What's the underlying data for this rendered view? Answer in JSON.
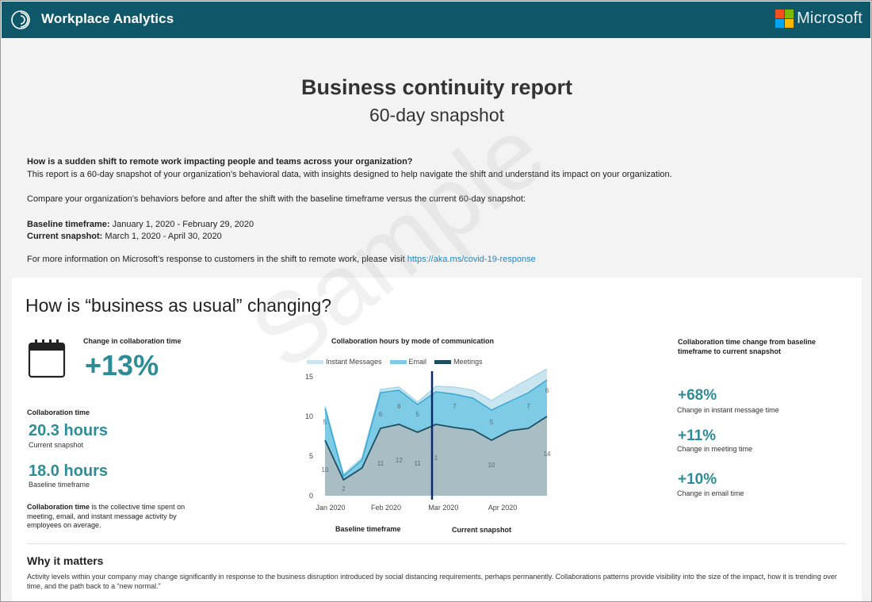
{
  "header": {
    "app_title": "Workplace Analytics",
    "brand": "Microsoft",
    "logo_icon": "workplace-analytics-logo"
  },
  "report": {
    "title": "Business continuity report",
    "subtitle": "60-day snapshot",
    "question": "How is a sudden shift to remote work impacting people and teams across your organization?",
    "intro": "This report is a 60-day snapshot of your organization’s behavioral data, with insights designed to help navigate the shift and understand its impact on your organization.",
    "compare": "Compare your organization’s behaviors before and after the shift with the baseline timeframe versus the current 60-day snapshot:",
    "baseline_label": "Baseline timeframe:",
    "baseline_value": " January 1, 2020 - February 29, 2020",
    "current_label": "Current snapshot:",
    "current_value": " March 1, 2020 - April 30, 2020",
    "more_info": "For more information on Microsoft’s response to customers in the shift to remote work, please visit ",
    "link": "https://aka.ms/covid-19-response"
  },
  "section": {
    "heading": "How is “business as usual” changing?",
    "change_label": "Change in collaboration time",
    "change_value": "+13%",
    "collab_label": "Collaboration time",
    "current_hours": "20.3 hours",
    "current_hours_label": "Current snapshot",
    "baseline_hours": "18.0 hours",
    "baseline_hours_label": "Baseline timeframe",
    "desc_bold": "Collaboration time",
    "desc_rest": " is the collective time spent on meeting, email, and instant message activity by employees on average.",
    "right_title": "Collaboration time change from baseline timeframe to current snapshot",
    "kpis": [
      {
        "value": "+68%",
        "label": "Change in instant message time"
      },
      {
        "value": "+11%",
        "label": "Change in meeting time"
      },
      {
        "value": "+10%",
        "label": "Change in email time"
      }
    ],
    "why_heading": "Why it matters",
    "why_text": "Activity levels within your company may change significantly in response to the business disruption introduced by social distancing requirements, perhaps permanently. Collaborations patterns provide visibility into the size of the impact, how it is trending over time, and the path back to a “new normal.”",
    "watermark": "Sample"
  },
  "colors": {
    "teal_header": "#0f5869",
    "accent": "#2e8c96",
    "im": "#c9e6f0",
    "email": "#7ecbe6",
    "meetings": "#1f4e61"
  },
  "chart_data": {
    "type": "area",
    "title": "Collaboration hours by mode of communication",
    "legend": [
      "Instant Messages",
      "Email",
      "Meetings"
    ],
    "legend_placement": "top",
    "stacked": true,
    "x_tick_labels": [
      "Jan 2020",
      "Feb 2020",
      "Mar 2020",
      "Apr 2020"
    ],
    "yticks": [
      "0",
      "5",
      "10",
      "15"
    ],
    "ylim": [
      0,
      15
    ],
    "divider_label_left": "Baseline timeframe",
    "divider_label_right": "Current snapshot",
    "series": [
      {
        "name": "Meetings",
        "values": [
          7.0,
          2.0,
          3.5,
          8.5,
          9.0,
          8.0,
          9.0,
          8.6,
          8.3,
          7.0,
          8.2,
          8.5,
          10.0
        ]
      },
      {
        "name": "Email",
        "values": [
          4.0,
          0.5,
          1.0,
          4.5,
          4.3,
          3.5,
          4.1,
          4.2,
          4.0,
          3.8,
          3.7,
          4.5,
          4.6
        ]
      },
      {
        "name": "Instant Messages",
        "values": [
          0.3,
          0.2,
          0.3,
          0.4,
          0.4,
          0.3,
          0.7,
          0.9,
          1.0,
          1.2,
          1.5,
          1.7,
          1.4
        ]
      }
    ],
    "data_labels": [
      {
        "text": "5",
        "index": 0,
        "level": 9
      },
      {
        "text": "10",
        "index": 0,
        "level": 3
      },
      {
        "text": "2",
        "index": 1,
        "level": 0.6
      },
      {
        "text": "6",
        "index": 3,
        "level": 10
      },
      {
        "text": "11",
        "index": 3,
        "level": 3.8
      },
      {
        "text": "6",
        "index": 4,
        "level": 11
      },
      {
        "text": "12",
        "index": 4,
        "level": 4.2
      },
      {
        "text": "5",
        "index": 5,
        "level": 10
      },
      {
        "text": "11",
        "index": 5,
        "level": 3.8
      },
      {
        "text": "1",
        "index": 6,
        "level": 4.5
      },
      {
        "text": "7",
        "index": 7,
        "level": 11
      },
      {
        "text": "5",
        "index": 9,
        "level": 9
      },
      {
        "text": "10",
        "index": 9,
        "level": 3.6
      },
      {
        "text": "7",
        "index": 11,
        "level": 11
      },
      {
        "text": "6",
        "index": 12,
        "level": 13
      },
      {
        "text": "14",
        "index": 12,
        "level": 5
      }
    ]
  }
}
